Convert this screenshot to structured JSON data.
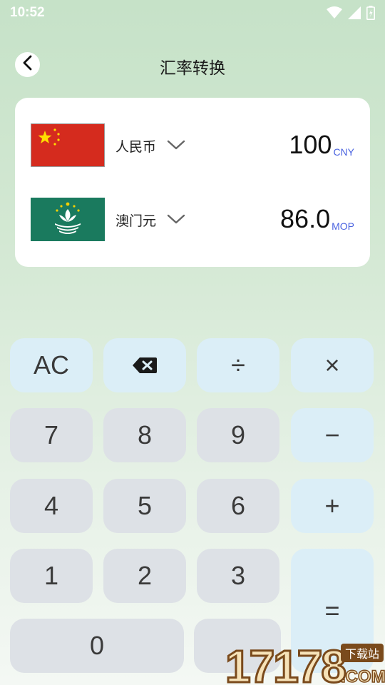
{
  "status": {
    "time": "10:52",
    "icons": [
      "wifi-icon",
      "cellular-signal-icon",
      "battery-icon"
    ]
  },
  "header": {
    "title": "汇率转换",
    "back_icon": "chevron-left-icon"
  },
  "converter": {
    "rows": [
      {
        "flag_icon": "china-flag-icon",
        "name": "人民币",
        "amount": "100",
        "code": "CNY"
      },
      {
        "flag_icon": "macau-flag-icon",
        "name": "澳门元",
        "amount": "86.0",
        "code": "MOP"
      }
    ]
  },
  "keypad": {
    "clear": "AC",
    "backspace_icon": "backspace-icon",
    "divide": "÷",
    "multiply": "×",
    "seven": "7",
    "eight": "8",
    "nine": "9",
    "minus": "−",
    "four": "4",
    "five": "5",
    "six": "6",
    "plus": "+",
    "one": "1",
    "two": "2",
    "three": "3",
    "equals": "=",
    "zero": "0",
    "dot": "."
  },
  "watermark": {
    "text": "17178",
    "sub": "下载站",
    "domain": ".COM"
  },
  "colors": {
    "accent_code": "#4a63e0",
    "number_key": "#dde1e6",
    "operator_key": "#dbeef7",
    "card": "#ffffff"
  }
}
